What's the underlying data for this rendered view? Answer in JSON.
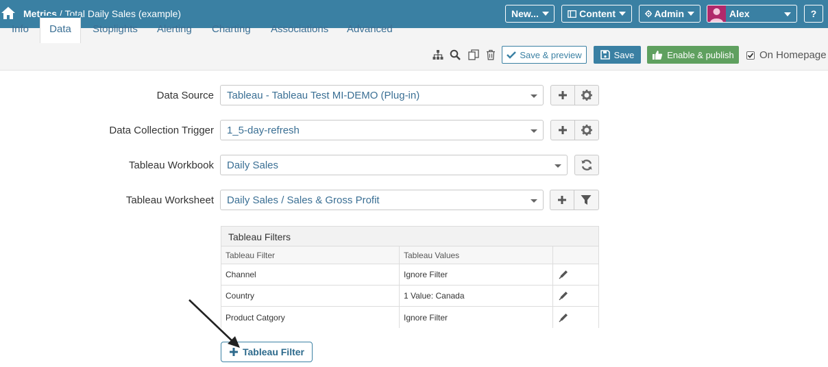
{
  "breadcrumb": {
    "root": "Metrics",
    "separator": " / ",
    "page": "Total Daily Sales (example)"
  },
  "topnav": {
    "new_label": "New...",
    "content_label": "Content",
    "admin_label": "Admin",
    "user_name": "Alex",
    "help_label": "?"
  },
  "tabs": [
    "Info",
    "Data",
    "Stoplights",
    "Alerting",
    "Charting",
    "Associations",
    "Advanced"
  ],
  "active_tab": "Data",
  "toolbar": {
    "save_preview_label": "Save & preview",
    "save_label": "Save",
    "publish_label": "Enable & publish",
    "homepage_label": "On Homepage",
    "homepage_checked": true
  },
  "form": {
    "data_source": {
      "label": "Data Source",
      "value": "Tableau - Tableau Test MI-DEMO (Plug-in)"
    },
    "trigger": {
      "label": "Data Collection Trigger",
      "value": "1_5-day-refresh"
    },
    "workbook": {
      "label": "Tableau Workbook",
      "value": "Daily Sales"
    },
    "worksheet": {
      "label": "Tableau Worksheet",
      "value": "Daily Sales / Sales & Gross Profit"
    }
  },
  "filters": {
    "title": "Tableau Filters",
    "columns": [
      "Tableau Filter",
      "Tableau Values"
    ],
    "rows": [
      {
        "filter": "Channel",
        "value": "Ignore Filter"
      },
      {
        "filter": "Country",
        "value": "1 Value: Canada"
      },
      {
        "filter": "Product Catgory",
        "value": "Ignore Filter"
      }
    ],
    "add_label": "Tableau Filter"
  },
  "colors": {
    "brand": "#3a80a3",
    "publish": "#5fa05f",
    "avatar": "#b0296b"
  }
}
